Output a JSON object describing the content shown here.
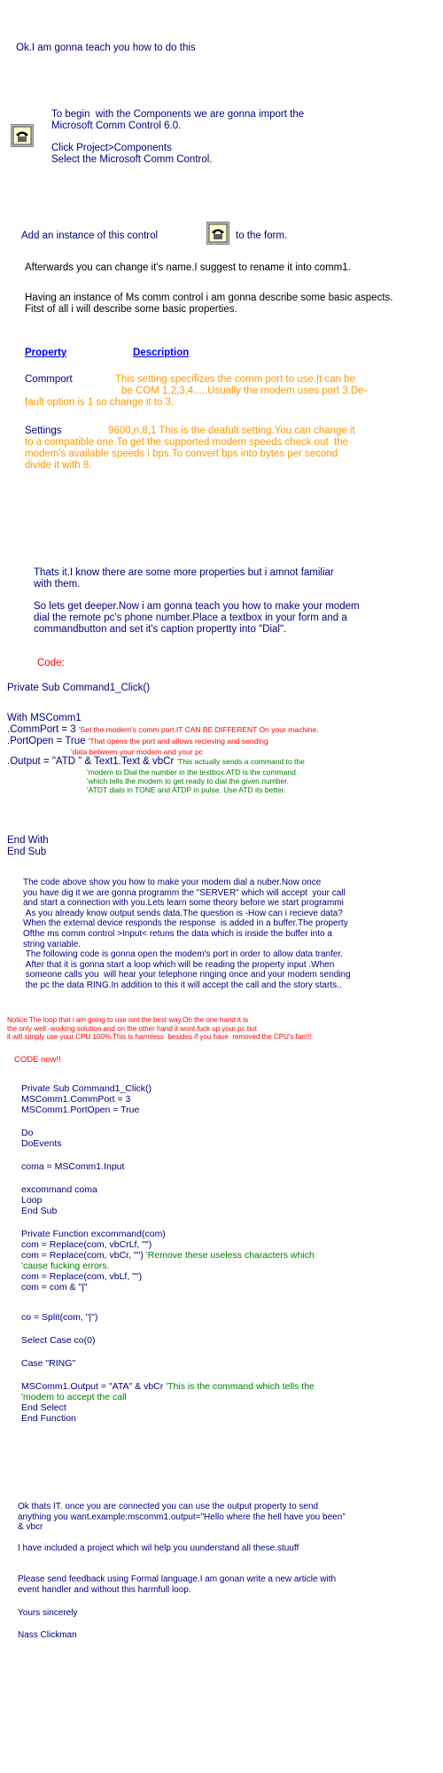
{
  "intro": "Ok.I am gonna teach you how to do this",
  "s1": {
    "l1": "To begin  with the Components we are gonna import the",
    "l2": "Microsoft Comm Control 6.0.",
    "l3": "Click Project>Components",
    "l4": "Select the Microsoft Comm Control."
  },
  "add_instance_a": "Add an instance of this control",
  "add_instance_b": "to the form.",
  "rename": "Afterwards you can change it's name.I suggest to rename it into comm1.",
  "describe": "Having an instance of Ms comm control i am gonna describe some basic aspects.\nFitst of all i will describe some basic properties.",
  "table": {
    "h_property": "Property",
    "h_description": "Description",
    "r1_name": "Commport",
    "r1_desc_a": "This setting specifizes the comm port to use.It can be",
    "r1_desc_b": "be COM 1,2,3,4.....Usually the modem uses port 3.De-",
    "r1_desc_c": "fault option is 1 so change it to 3.",
    "r2_name": "Settings",
    "r2_desc_a": "9600,n,8,1 This is the deafult setting.You can change it",
    "r2_desc_b": "to a compatible one.To get the supported modem speeds check out  the",
    "r2_desc_c": "modem's available speeds i bps.To convert bps into bytes per second",
    "r2_desc_d": "divide it with 8."
  },
  "thats_it": "Thats it.I know there are some more properties but i amnot familiar\nwith them.",
  "deeper": "So lets get deeper.Now i am gonna teach you how to make your modem\ndial the remote pc's phone number.Place a textbox in your form and a\ncommandbutton and set it's caption propertty into \"Dial\".",
  "code_label": "Code:",
  "code1": {
    "sub": "Private Sub Command1_Click()",
    "with": "With MSComm1",
    "commport": ".CommPort = 3",
    "commport_c": "'Set the modem's comm port.IT CAN BE DIFFERENT On your machine.",
    "portopen": ".PortOpen = True",
    "portopen_c": "'That opens the port and allows recieving and sending",
    "portopen_c2": "'data between your modem and your pc",
    "output": ".Output = \"ATD \" & Text1.Text & vbCr",
    "output_c1": "'This actually sends a command to the",
    "output_c2": "'modem to Dial the number in the textbox.ATD is the command",
    "output_c3": "'which tells the modem to get ready to dial the given number.",
    "output_c4": "'ATDT dials in TONE and ATDP in pulse. Use ATD its better.",
    "endwith": "End With",
    "endsub": "End Sub"
  },
  "explain": "The code above show you how to make your modem dial a nuber.Now once\nyou have dig it we are gonna programm the \"SERVER\" which will accept  your call\nand start a connection with you.Lets learn some theory before we start programmi\n As you already know output sends data.The question is -How can i recieve data?\nWhen the external device responds the response  is added in a buffer.The property\nOfthe ms comm control >Input< retuns the data which is inside the buffer into a\nstring variable.\n The following code is gonna open the modem's port in order to allow data tranfer.\n After that it is gonna start a loop which will be reading the property input .When\n someone calls you  will hear your telephone ringing once and your modem sending\n the pc the data RING.In addition to this it will accept the call and the story starts..",
  "notice": "Notice:The loop that i am going to use isnt the best way.On the one hand it is\nthe only well -working solution and on the other hand it wont fuck up your pc but\nit will simply use your CPU 100%.This is harmless  besides if you have  removed the CPU's fan!!!",
  "code_now": "CODE now!!",
  "code2": {
    "a": "Private Sub Command1_Click()\nMSComm1.CommPort = 3\nMSComm1.PortOpen = True",
    "b": "Do\nDoEvents",
    "c": "coma = MSComm1.Input",
    "d": "excommand coma\nLoop\nEnd Sub",
    "e1": "Private Function excommand(com)\ncom = Replace(com, vbCrLf, \"\")\ncom = Replace(com, vbCr, \"\")",
    "e1_c": "'Remove these useless characters which\n'cause fucking errors.",
    "e2": "com = Replace(com, vbLf, \"\")\ncom = com & \"|\"",
    "f": "co = Split(com, \"|\")",
    "g": "Select Case co(0)",
    "h": "Case \"RING\"",
    "i": "MSComm1.Output = \"ATA\" & vbCr",
    "i_c": "'This is the command which tells the\n'modem to accept the call",
    "j": "End Select\nEnd Function"
  },
  "ok_thats": "Ok thats IT. once you are connected you can use the output property to send\nanything you want.example:mscomm1.output=\"Hello where the hell have you been\"\n& vbcr",
  "included": "I have included a project which wil help you uunderstand all these.stuuff",
  "feedback": "Please send feedback using Formal language.I am gonan write a new article with\nevent handler and without this harmfull loop.",
  "yours": "Yours sincerely",
  "author": "Nass Clickman",
  "icons": {
    "component_icon": "comm-control-telephone-icon"
  }
}
